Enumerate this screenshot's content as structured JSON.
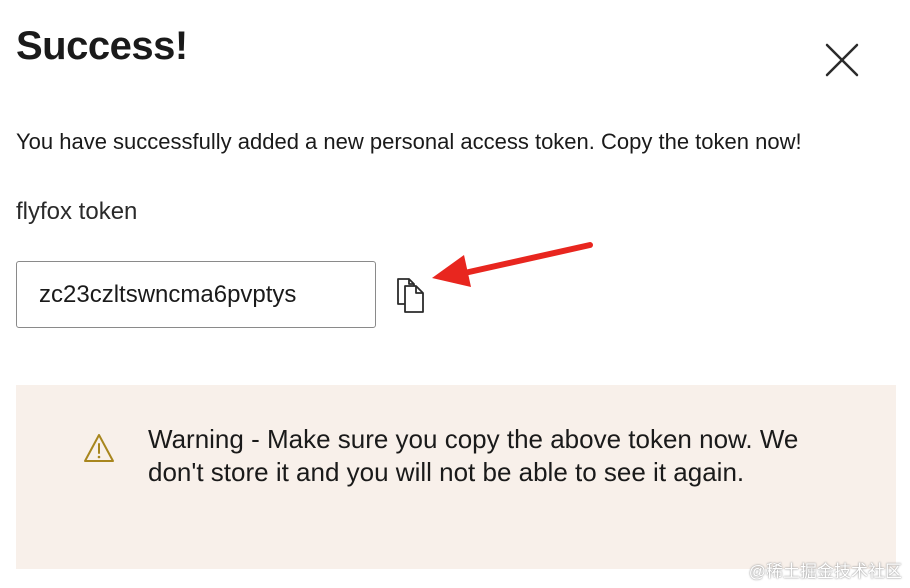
{
  "dialog": {
    "title": "Success!",
    "close_icon": "close-icon",
    "message": "You have successfully added a new personal access token. Copy the token now!",
    "token_name": "flyfox token",
    "token_value": "zc23czltswncma6pvptys",
    "copy_icon": "copy-icon"
  },
  "annotation": {
    "arrow_color": "#e8261f"
  },
  "warning": {
    "icon": "warning-triangle-icon",
    "icon_color": "#a8861e",
    "background": "#f8f0ea",
    "text": "Warning - Make sure you copy the above token now. We don't store it and you will not be able to see it again."
  },
  "watermark": {
    "text": "@稀土掘金技术社区"
  }
}
